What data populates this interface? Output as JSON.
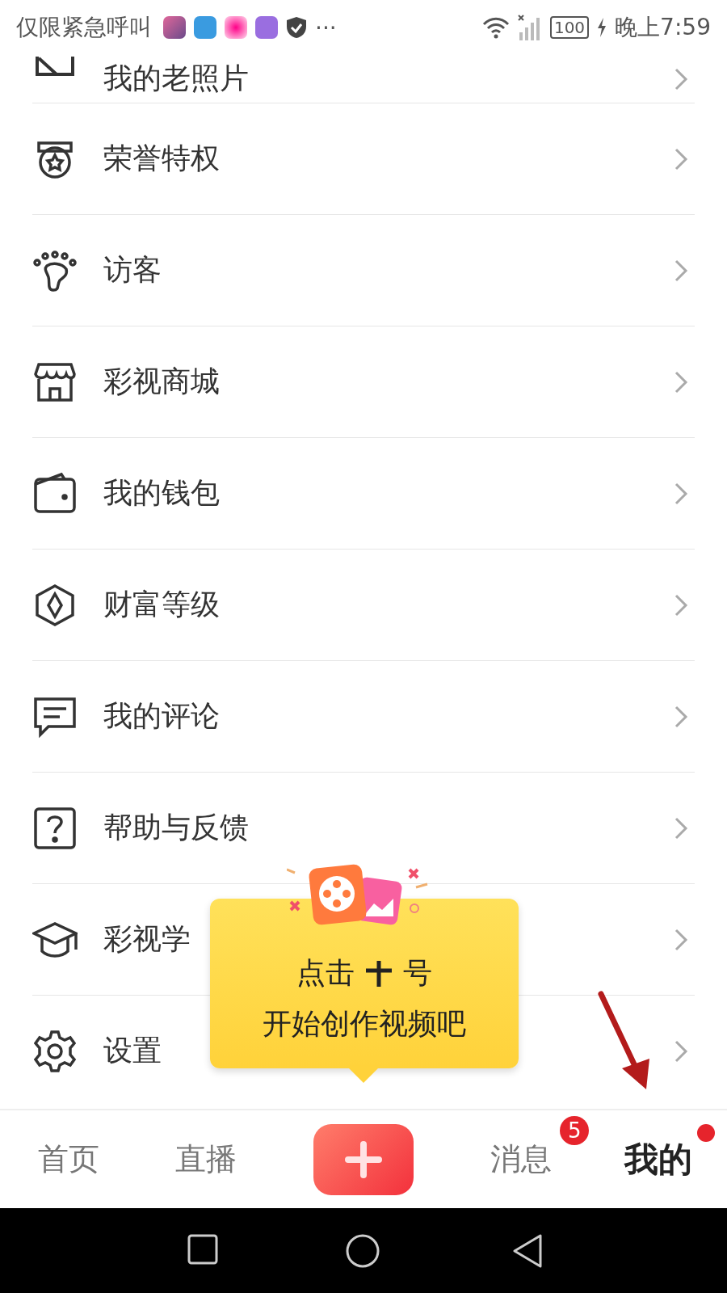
{
  "status_bar": {
    "notice": "仅限紧急呼叫",
    "more": "···",
    "battery": "100",
    "time": "晚上7:59"
  },
  "menu": [
    {
      "label": "我的老照片"
    },
    {
      "label": "荣誉特权"
    },
    {
      "label": "访客"
    },
    {
      "label": "彩视商城"
    },
    {
      "label": "我的钱包"
    },
    {
      "label": "财富等级"
    },
    {
      "label": "我的评论"
    },
    {
      "label": "帮助与反馈"
    },
    {
      "label": "彩视学"
    },
    {
      "label": "设置"
    }
  ],
  "tooltip": {
    "line1_before": "点击",
    "line1_after": "号",
    "line2": "开始创作视频吧"
  },
  "tabs": [
    {
      "label": "首页",
      "selected": false
    },
    {
      "label": "直播",
      "selected": false
    },
    {
      "kind": "create"
    },
    {
      "label": "消息",
      "selected": false,
      "badge": "5"
    },
    {
      "label": "我的",
      "selected": true,
      "dot": true
    }
  ]
}
